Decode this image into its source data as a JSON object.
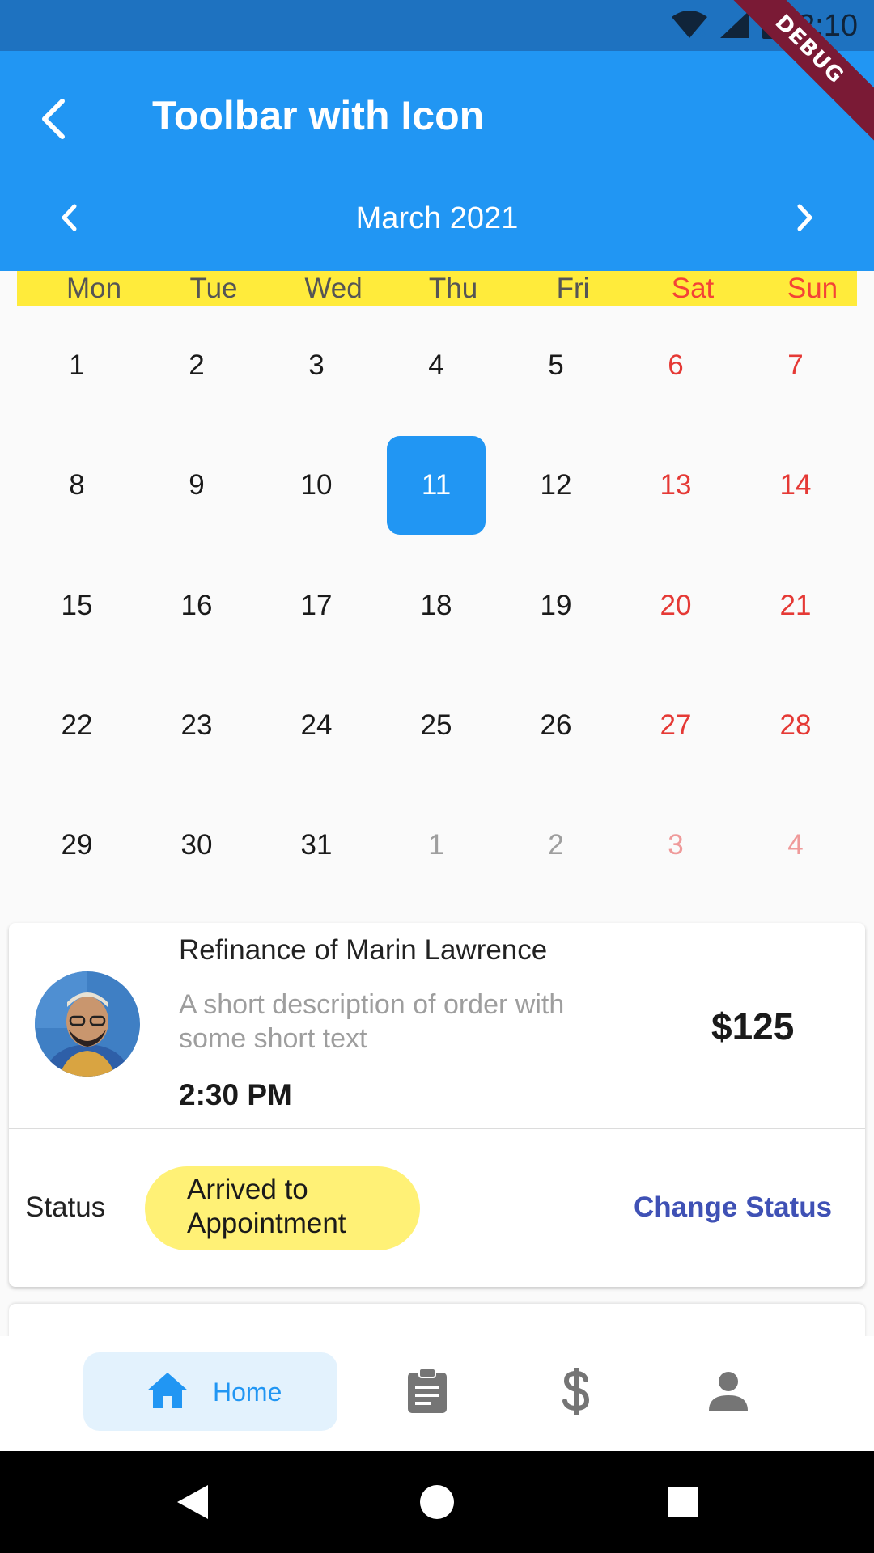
{
  "status_bar": {
    "time": "2:10"
  },
  "debug_banner": "DEBUG",
  "toolbar": {
    "title": "Toolbar with Icon"
  },
  "calendar": {
    "month_label": "March 2021",
    "weekdays": [
      "Mon",
      "Tue",
      "Wed",
      "Thu",
      "Fri",
      "Sat",
      "Sun"
    ],
    "weeks": [
      [
        "1",
        "2",
        "3",
        "4",
        "5",
        "6",
        "7"
      ],
      [
        "8",
        "9",
        "10",
        "11",
        "12",
        "13",
        "14"
      ],
      [
        "15",
        "16",
        "17",
        "18",
        "19",
        "20",
        "21"
      ],
      [
        "22",
        "23",
        "24",
        "25",
        "26",
        "27",
        "28"
      ],
      [
        "29",
        "30",
        "31",
        "1",
        "2",
        "3",
        "4"
      ]
    ],
    "selected_day": "11"
  },
  "order": {
    "title": "Refinance of Marin Lawrence",
    "description": "A short description of order with some short text",
    "time": "2:30 PM",
    "price": "$125",
    "status_label": "Status",
    "status_value": "Arrived to Appointment",
    "change_status": "Change Status"
  },
  "bottom_nav": {
    "home_label": "Home"
  }
}
